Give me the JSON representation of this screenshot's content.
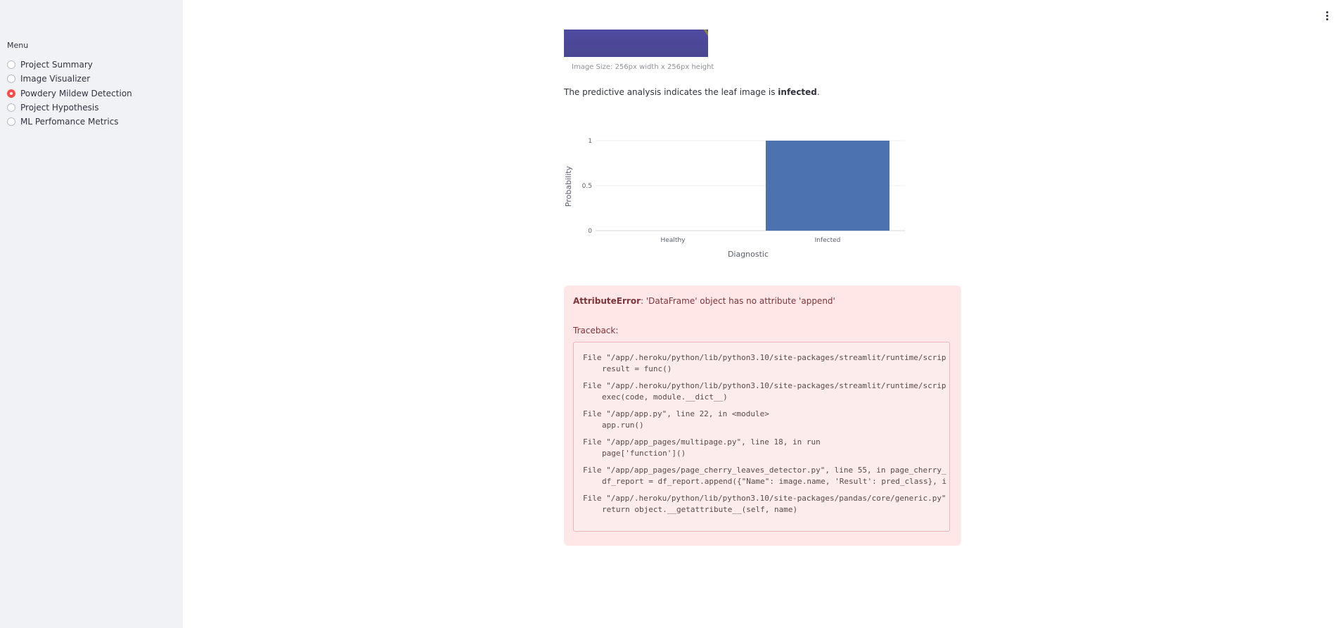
{
  "sidebar": {
    "menu_label": "Menu",
    "items": [
      {
        "label": "Project Summary",
        "selected": false
      },
      {
        "label": "Image Visualizer",
        "selected": false
      },
      {
        "label": "Powdery Mildew Detection",
        "selected": true
      },
      {
        "label": "Project Hypothesis",
        "selected": false
      },
      {
        "label": "ML Perfomance Metrics",
        "selected": false
      }
    ]
  },
  "header": {
    "menu_icon": "more-vertical-icon"
  },
  "main": {
    "image_caption": "Image Size: 256px width x 256px height",
    "prediction_prefix": "The predictive analysis indicates the leaf image is ",
    "prediction_value": "infected",
    "prediction_suffix": "."
  },
  "chart_data": {
    "type": "bar",
    "categories": [
      "Healthy",
      "Infected"
    ],
    "values": [
      0,
      1
    ],
    "xlabel": "Diagnostic",
    "ylabel": "Probability",
    "ylim": [
      0,
      1
    ],
    "yticks": [
      "0",
      "0.5",
      "1"
    ],
    "color": "#4c72b0",
    "grid": true
  },
  "error": {
    "type": "AttributeError",
    "message": ": 'DataFrame' object has no attribute 'append'",
    "traceback_label": "Traceback:",
    "entries": [
      {
        "file": "File \"/app/.heroku/python/lib/python3.10/site-packages/streamlit/runtime/scrip",
        "code": "result = func()"
      },
      {
        "file": "File \"/app/.heroku/python/lib/python3.10/site-packages/streamlit/runtime/scrip",
        "code": "exec(code, module.__dict__)"
      },
      {
        "file": "File \"/app/app.py\", line 22, in <module>",
        "code": "app.run()"
      },
      {
        "file": "File \"/app/app_pages/multipage.py\", line 18, in run",
        "code": "page['function']()"
      },
      {
        "file": "File \"/app/app_pages/page_cherry_leaves_detector.py\", line 55, in page_cherry_",
        "code": "df_report = df_report.append({\"Name\": image.name, 'Result': pred_class}, i"
      },
      {
        "file": "File \"/app/.heroku/python/lib/python3.10/site-packages/pandas/core/generic.py\"",
        "code": "return object.__getattribute__(self, name)"
      }
    ]
  }
}
